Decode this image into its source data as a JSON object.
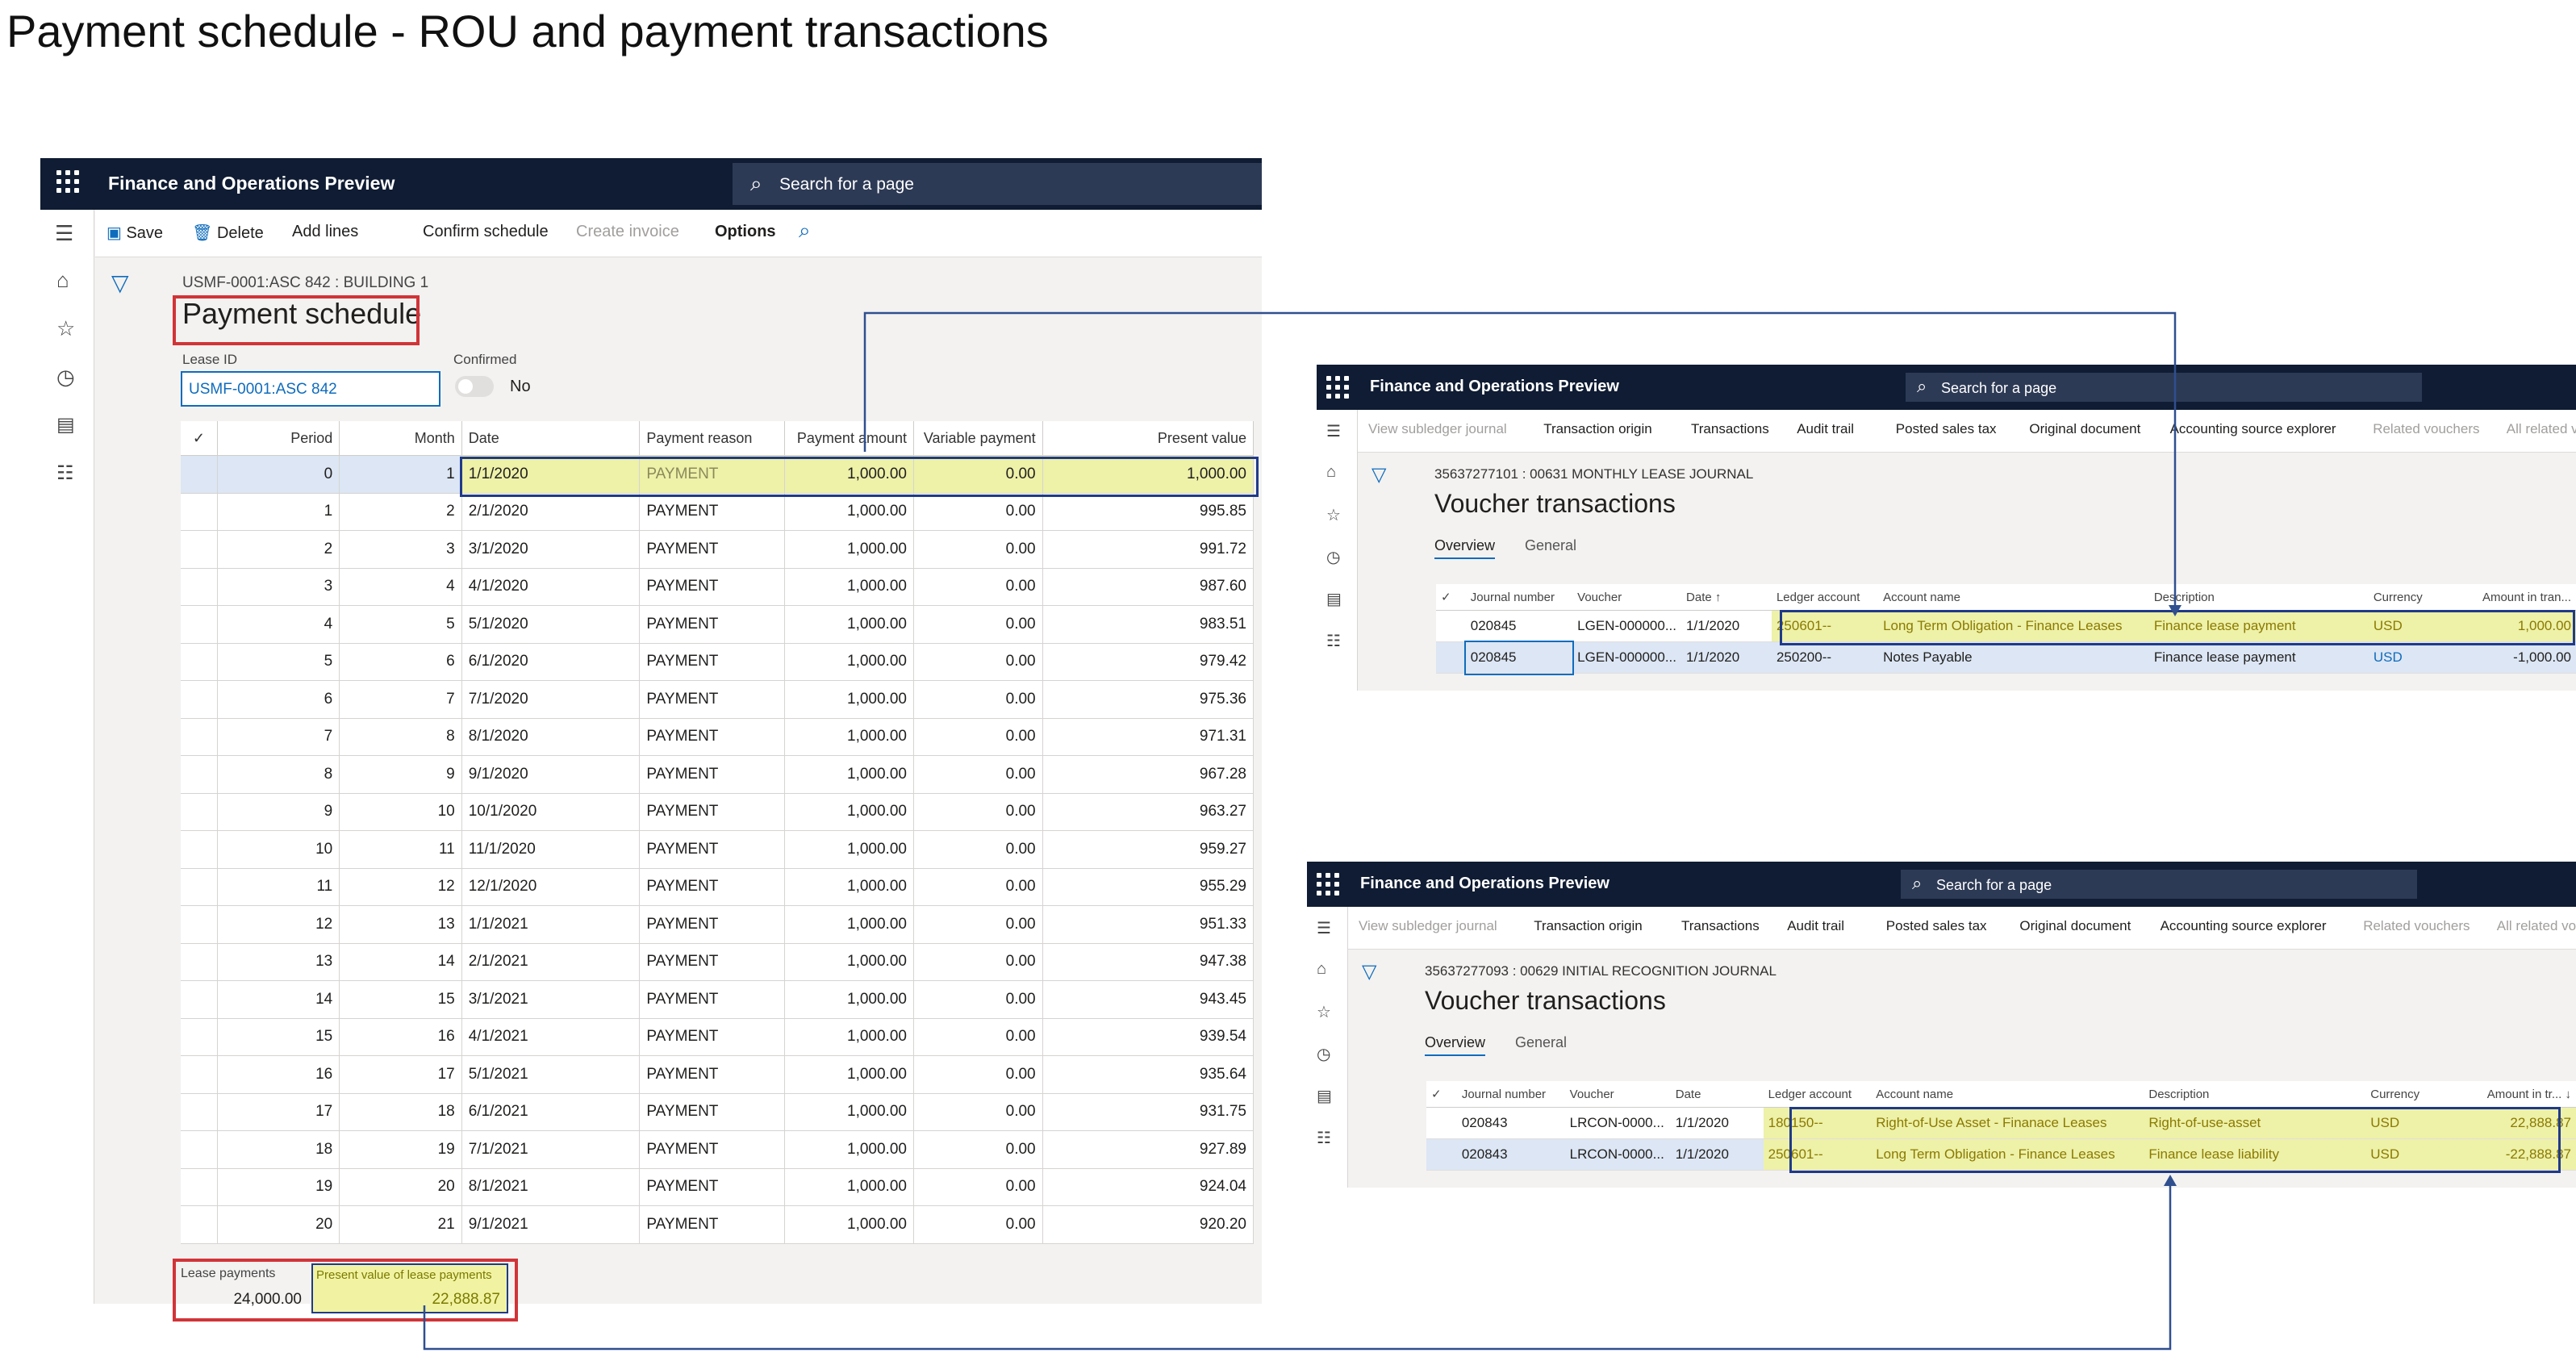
{
  "page_title": "Payment schedule -  ROU and payment transactions",
  "colors": {
    "nav_bg": "#0f1c33",
    "highlight_red": "#d13438",
    "highlight_yellow": "#f1f3a2",
    "connector_blue": "#2f4f8f"
  },
  "schedule_window": {
    "app_name": "Finance and Operations Preview",
    "search_placeholder": "Search for a page",
    "toolbar": {
      "save": "Save",
      "delete": "Delete",
      "add_lines": "Add lines",
      "confirm_schedule": "Confirm schedule",
      "create_invoice": "Create invoice",
      "options": "Options"
    },
    "breadcrumb": "USMF-0001:ASC 842 : BUILDING 1",
    "heading": "Payment schedule",
    "lease_id_label": "Lease ID",
    "lease_id_value": "USMF-0001:ASC 842",
    "confirmed_label": "Confirmed",
    "confirmed_value": "No",
    "columns": [
      "Period",
      "Month",
      "Date",
      "Payment reason",
      "Payment amount",
      "Variable payment",
      "Present value"
    ],
    "rows": [
      [
        "0",
        "1",
        "1/1/2020",
        "PAYMENT",
        "1,000.00",
        "0.00",
        "1,000.00"
      ],
      [
        "1",
        "2",
        "2/1/2020",
        "PAYMENT",
        "1,000.00",
        "0.00",
        "995.85"
      ],
      [
        "2",
        "3",
        "3/1/2020",
        "PAYMENT",
        "1,000.00",
        "0.00",
        "991.72"
      ],
      [
        "3",
        "4",
        "4/1/2020",
        "PAYMENT",
        "1,000.00",
        "0.00",
        "987.60"
      ],
      [
        "4",
        "5",
        "5/1/2020",
        "PAYMENT",
        "1,000.00",
        "0.00",
        "983.51"
      ],
      [
        "5",
        "6",
        "6/1/2020",
        "PAYMENT",
        "1,000.00",
        "0.00",
        "979.42"
      ],
      [
        "6",
        "7",
        "7/1/2020",
        "PAYMENT",
        "1,000.00",
        "0.00",
        "975.36"
      ],
      [
        "7",
        "8",
        "8/1/2020",
        "PAYMENT",
        "1,000.00",
        "0.00",
        "971.31"
      ],
      [
        "8",
        "9",
        "9/1/2020",
        "PAYMENT",
        "1,000.00",
        "0.00",
        "967.28"
      ],
      [
        "9",
        "10",
        "10/1/2020",
        "PAYMENT",
        "1,000.00",
        "0.00",
        "963.27"
      ],
      [
        "10",
        "11",
        "11/1/2020",
        "PAYMENT",
        "1,000.00",
        "0.00",
        "959.27"
      ],
      [
        "11",
        "12",
        "12/1/2020",
        "PAYMENT",
        "1,000.00",
        "0.00",
        "955.29"
      ],
      [
        "12",
        "13",
        "1/1/2021",
        "PAYMENT",
        "1,000.00",
        "0.00",
        "951.33"
      ],
      [
        "13",
        "14",
        "2/1/2021",
        "PAYMENT",
        "1,000.00",
        "0.00",
        "947.38"
      ],
      [
        "14",
        "15",
        "3/1/2021",
        "PAYMENT",
        "1,000.00",
        "0.00",
        "943.45"
      ],
      [
        "15",
        "16",
        "4/1/2021",
        "PAYMENT",
        "1,000.00",
        "0.00",
        "939.54"
      ],
      [
        "16",
        "17",
        "5/1/2021",
        "PAYMENT",
        "1,000.00",
        "0.00",
        "935.64"
      ],
      [
        "17",
        "18",
        "6/1/2021",
        "PAYMENT",
        "1,000.00",
        "0.00",
        "931.75"
      ],
      [
        "18",
        "19",
        "7/1/2021",
        "PAYMENT",
        "1,000.00",
        "0.00",
        "927.89"
      ],
      [
        "19",
        "20",
        "8/1/2021",
        "PAYMENT",
        "1,000.00",
        "0.00",
        "924.04"
      ],
      [
        "20",
        "21",
        "9/1/2021",
        "PAYMENT",
        "1,000.00",
        "0.00",
        "920.20"
      ]
    ],
    "footer": {
      "lease_payments_label": "Lease payments",
      "lease_payments_value": "24,000.00",
      "pv_label": "Present value of lease payments",
      "pv_value": "22,888.87"
    }
  },
  "monthly_window": {
    "app_name": "Finance and Operations Preview",
    "search_placeholder": "Search for a page",
    "toolbar": [
      "View subledger journal",
      "Transaction origin",
      "Transactions",
      "Audit trail",
      "Posted sales tax",
      "Original document",
      "Accounting source explorer",
      "Related vouchers",
      "All related vouchers"
    ],
    "journal": "35637277101 : 00631 MONTHLY LEASE JOURNAL",
    "heading": "Voucher transactions",
    "tabs": [
      "Overview",
      "General"
    ],
    "columns": [
      "Journal number",
      "Voucher",
      "Date ↑",
      "Ledger account",
      "Account name",
      "Description",
      "Currency",
      "Amount in tran..."
    ],
    "rows": [
      [
        "020845",
        "LGEN-000000...",
        "1/1/2020",
        "250601--",
        "Long Term Obligation - Finance Leases",
        "Finance lease payment",
        "USD",
        "1,000.00"
      ],
      [
        "020845",
        "LGEN-000000...",
        "1/1/2020",
        "250200--",
        "Notes Payable",
        "Finance lease payment",
        "USD",
        "-1,000.00"
      ]
    ]
  },
  "initial_window": {
    "app_name": "Finance and Operations Preview",
    "search_placeholder": "Search for a page",
    "toolbar": [
      "View subledger journal",
      "Transaction origin",
      "Transactions",
      "Audit trail",
      "Posted sales tax",
      "Original document",
      "Accounting source explorer",
      "Related vouchers",
      "All related vouchers"
    ],
    "journal": "35637277093 : 00629 INITIAL RECOGNITION JOURNAL",
    "heading": "Voucher transactions",
    "tabs": [
      "Overview",
      "General"
    ],
    "columns": [
      "Journal number",
      "Voucher",
      "Date",
      "Ledger account",
      "Account name",
      "Description",
      "Currency",
      "Amount in tr... ↓"
    ],
    "rows": [
      [
        "020843",
        "LRCON-0000...",
        "1/1/2020",
        "180150--",
        "Right-of-Use Asset - Finanace Leases",
        "Right-of-use-asset",
        "USD",
        "22,888.87"
      ],
      [
        "020843",
        "LRCON-0000...",
        "1/1/2020",
        "250601--",
        "Long Term Obligation - Finance Leases",
        "Finance lease liability",
        "USD",
        "-22,888.87"
      ]
    ]
  }
}
